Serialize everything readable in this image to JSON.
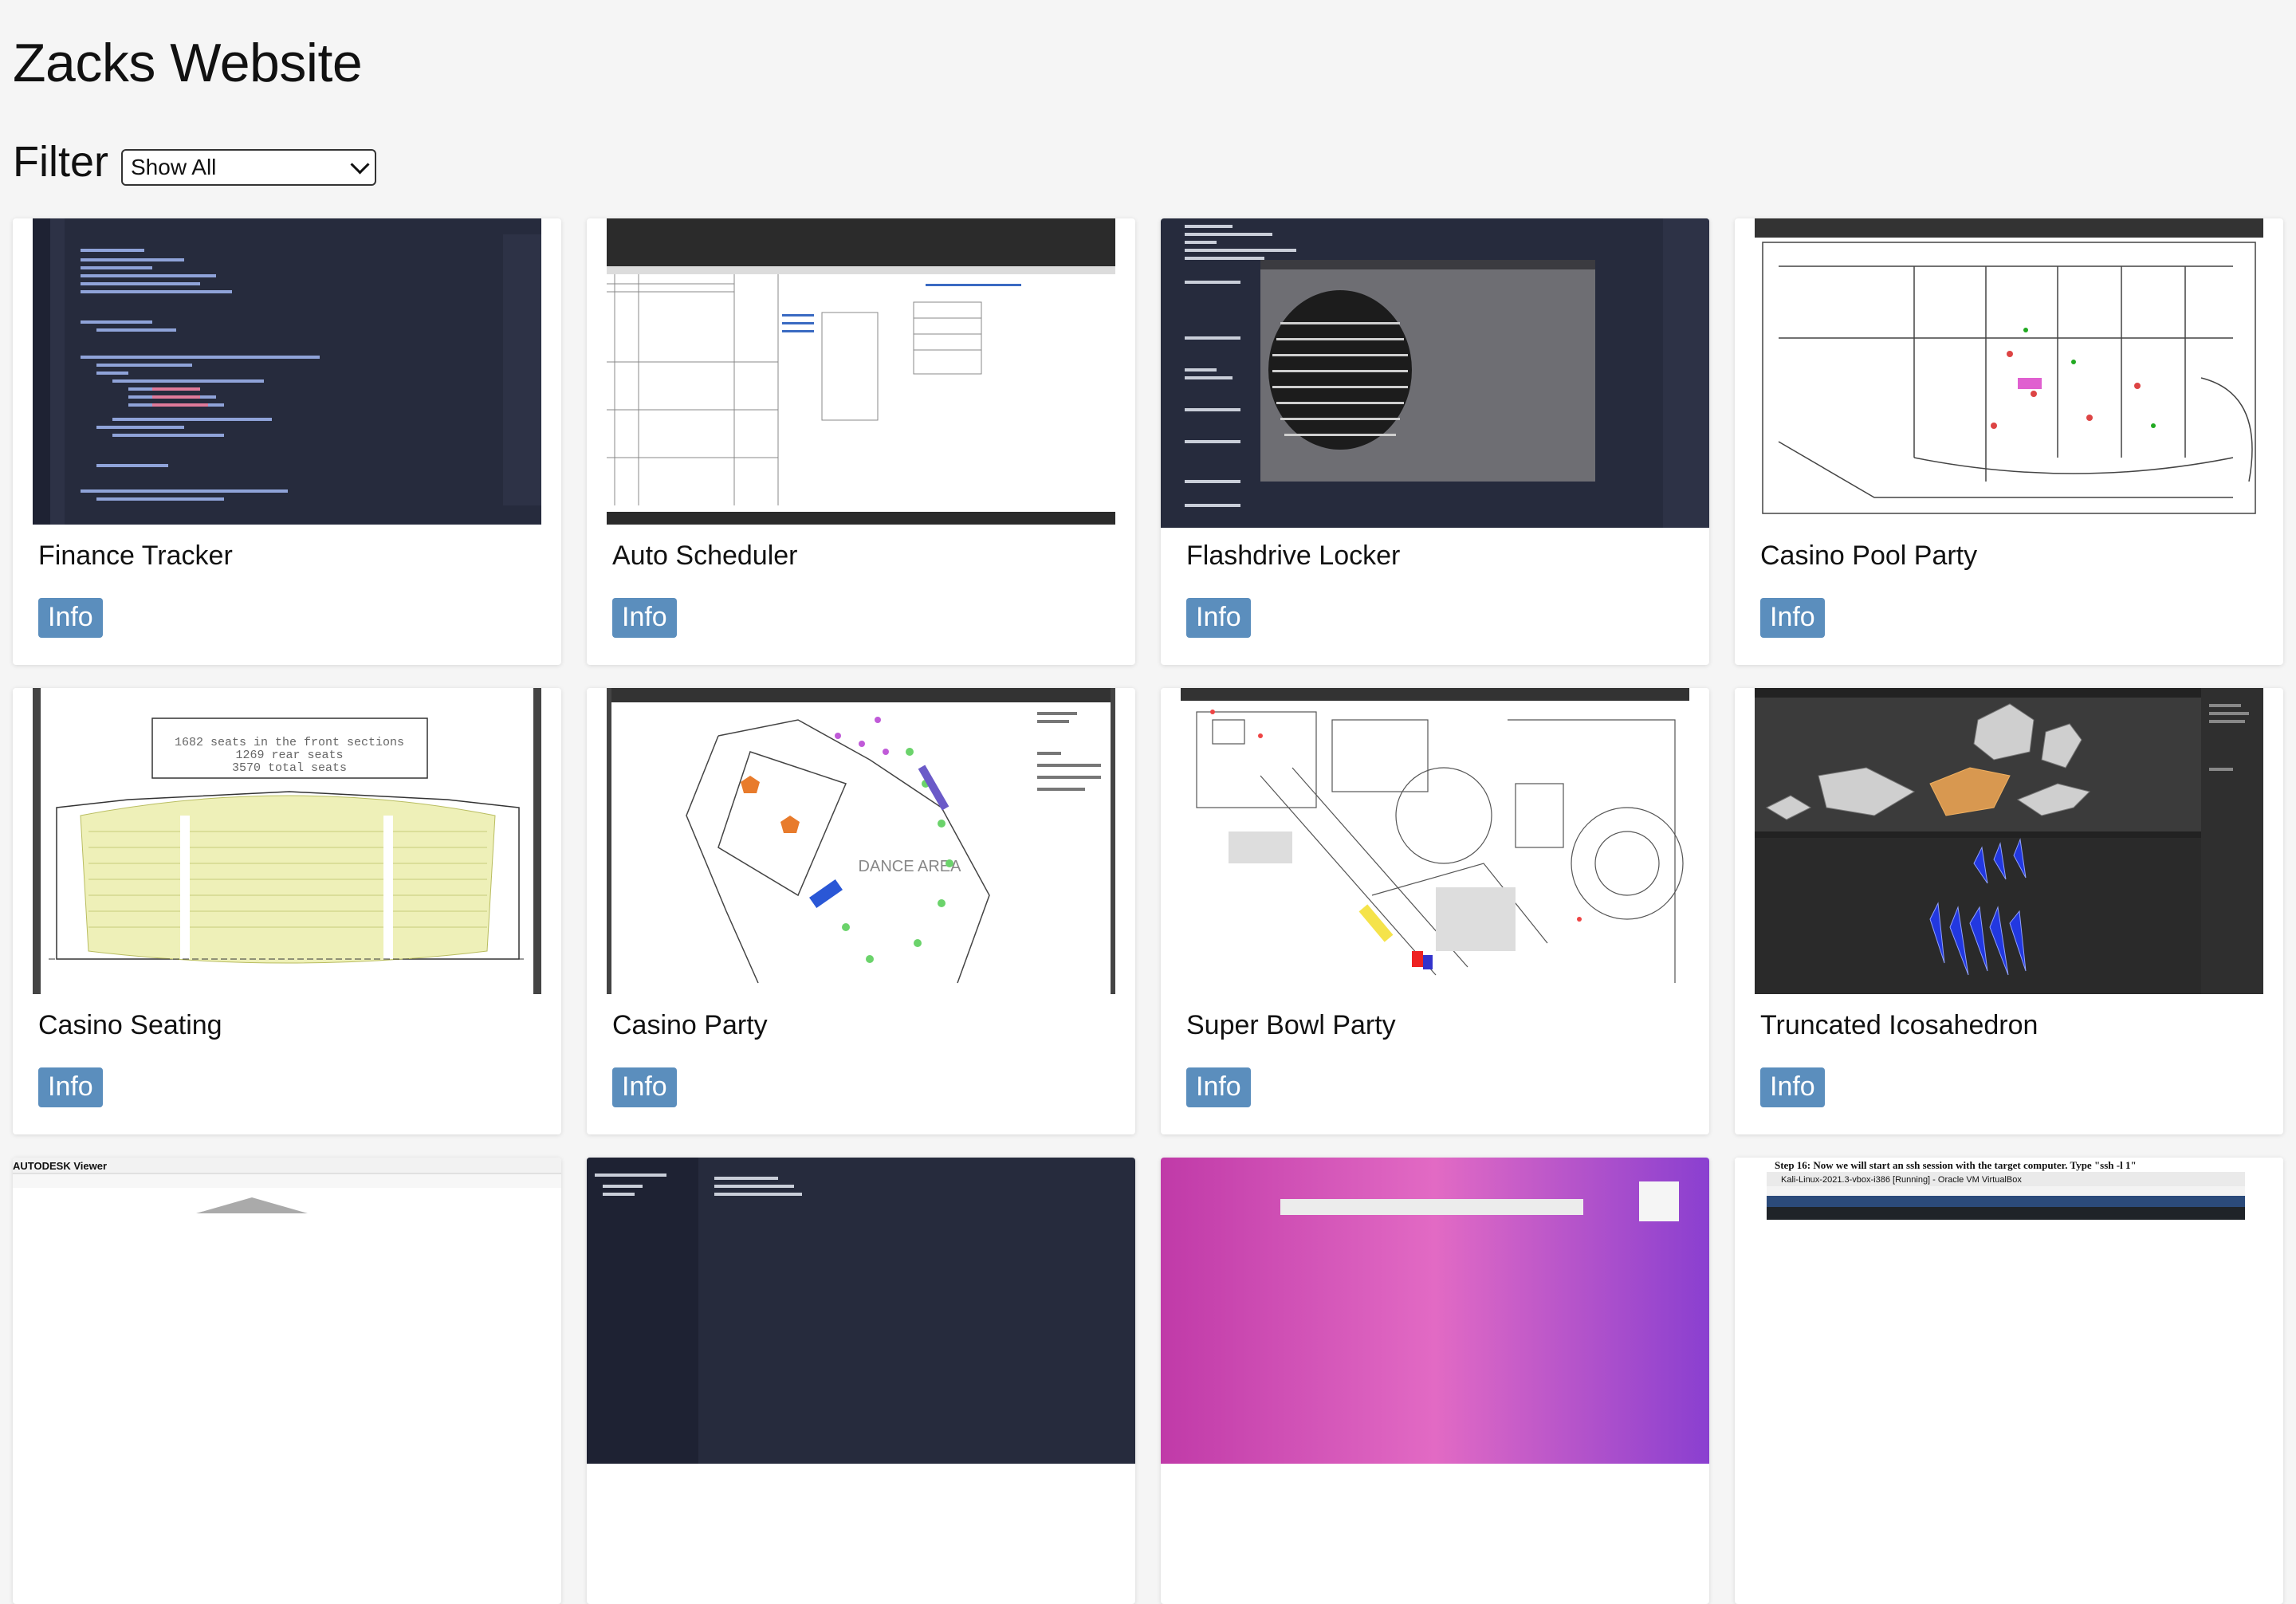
{
  "site": {
    "title": "Zacks Website"
  },
  "filter": {
    "label": "Filter",
    "selected": "Show All"
  },
  "projects": [
    {
      "title": "Finance Tracker",
      "button": "Info",
      "thumb": "code-editor-screenshot"
    },
    {
      "title": "Auto Scheduler",
      "button": "Info",
      "thumb": "spreadsheet-screenshot"
    },
    {
      "title": "Flashdrive Locker",
      "button": "Info",
      "thumb": "terminal-ascii-art-screenshot"
    },
    {
      "title": "Casino Pool Party",
      "button": "Info",
      "thumb": "floor-plan-screenshot"
    },
    {
      "title": "Casino Seating",
      "button": "Info",
      "thumb": "seating-chart-screenshot"
    },
    {
      "title": "Casino Party",
      "button": "Info",
      "thumb": "party-floor-plan-screenshot"
    },
    {
      "title": "Super Bowl Party",
      "button": "Info",
      "thumb": "building-plan-screenshot"
    },
    {
      "title": "Truncated Icosahedron",
      "button": "Info",
      "thumb": "blender-3d-screenshot"
    },
    {
      "title": "",
      "button": "",
      "thumb": "autodesk-viewer-screenshot"
    },
    {
      "title": "",
      "button": "",
      "thumb": "code-editor-screenshot"
    },
    {
      "title": "",
      "button": "",
      "thumb": "macos-desktop-screenshot"
    },
    {
      "title": "",
      "button": "",
      "thumb": "virtualbox-kali-screenshot"
    }
  ],
  "thumb_texts": {
    "seating_line1": "1682 seats in the front sections",
    "seating_line2": "1269 rear seats",
    "seating_line3": "3570 total seats",
    "party_area": "DANCE AREA",
    "vbox_step": "Step 16: Now we will start an ssh session with the target computer. Type \"ssh -l 1\"",
    "vbox_window": "Kali-Linux-2021.3-vbox-i386 [Running] - Oracle VM VirtualBox",
    "autodesk": "AUTODESK Viewer"
  },
  "colors": {
    "accent": "#5b8ebd",
    "editor_bg": "#262b3d"
  }
}
